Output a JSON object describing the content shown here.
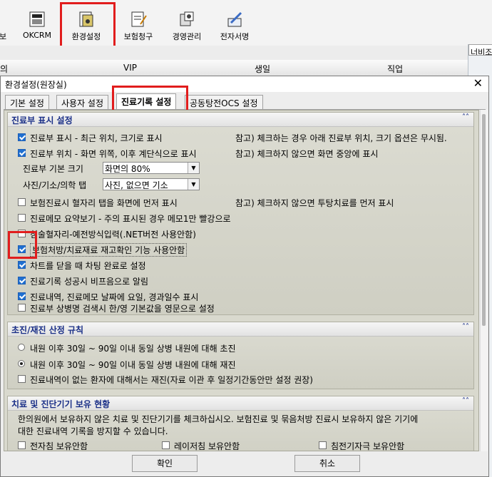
{
  "toolbar": {
    "cut_label": "보",
    "okcrm_label": "OKCRM",
    "env_label": "환경설정",
    "insurance_label": "보험청구",
    "management_label": "경영관리",
    "esign_label": "전자서명"
  },
  "background": {
    "left_fragment": "의",
    "col_vip": "VIP",
    "col_birthday": "생일",
    "col_job": "직업",
    "right_tab": "너비조"
  },
  "dialog": {
    "title": "환경설정(원장실)",
    "close": "✕",
    "tabs": [
      "기본 설정",
      "사용자 설정",
      "진료기록 설정",
      "공동탕전OCS 설정"
    ],
    "active_tab": 2,
    "ok_label": "확인",
    "cancel_label": "취소"
  },
  "sections": {
    "chart": {
      "title": "진료부 표시 설정",
      "items": [
        {
          "label": "진료부 표시 - 최근 위치, 크기로 표시",
          "checked": true,
          "note": "참고) 체크하는 경우 아래 진료부 위치, 크기 옵션은 무시됨."
        },
        {
          "label": "진료부 위치 - 화면 위쪽, 이후 계단식으로 표시",
          "checked": true,
          "note": "참고) 체크하지 않으면 화면 중앙에 표시"
        }
      ],
      "size_label": "진료부 기본 크기",
      "size_value": "화면의 80%",
      "tab_label": "사진/기소/의학 탭",
      "tab_value": "사진, 없으면 기소",
      "items2": [
        {
          "label": "보험진료시 혈자리 탭을 화면에 먼저 표시",
          "checked": false,
          "note": "참고) 체크하지 않으면 투탕치료를 먼저 표시"
        },
        {
          "label": "진료메모 요약보기 - 주의 표시된 경우 메모1만 빨강으로",
          "checked": false
        },
        {
          "label": "침술혈자리-예전방식입력(.NET버전 사용안함)",
          "checked": false
        },
        {
          "label": "보험처방/치료재료 재고확인 기능 사용안함",
          "checked": true
        },
        {
          "label": "차트를 닫을 때 차팅 완료로 설정",
          "checked": true
        },
        {
          "label": "진료기록 성공시 비프음으로 알림",
          "checked": true
        },
        {
          "label": "진료내역, 진료메모 날짜에 요일, 경과일수 표시",
          "checked": true
        },
        {
          "label": "진료부 상병명 검색시 한/영 기본값을 영문으로 설정",
          "checked": false
        }
      ]
    },
    "visit": {
      "title": "초진/재진 산정 규칙",
      "options": [
        {
          "label": "내원 이후 30일 ~ 90일 이내 동일 상병 내원에 대해 초진",
          "selected": false
        },
        {
          "label": "내원 이후 30일 ~ 90일 이내 동일 상병 내원에 대해 재진",
          "selected": true
        }
      ],
      "extra": {
        "label": "진료내역이 없는 환자에 대해서는 재진(자료 이관 후 일정기간동안만 설정 권장)",
        "checked": false
      }
    },
    "equipment": {
      "title": "치료 및 진단기기 보유 현황",
      "desc1": "한의원에서 보유하지 않은 치료 및 진단기기를 체크하십시오. 보험진료 및 묶음처방 진료시 보유하지 않은 기기에",
      "desc2": "대한 진료내역 기록을 방지할 수 있습니다.",
      "items": [
        {
          "label": "전자침 보유안함",
          "checked": false
        },
        {
          "label": "레이저침 보유안함",
          "checked": false
        },
        {
          "label": "침전기자극 보유안함",
          "checked": false
        }
      ]
    }
  },
  "colors": {
    "accent_red": "#e11d1d",
    "section_title": "#1a2f87",
    "checkbox_on": "#1f6fd1"
  }
}
